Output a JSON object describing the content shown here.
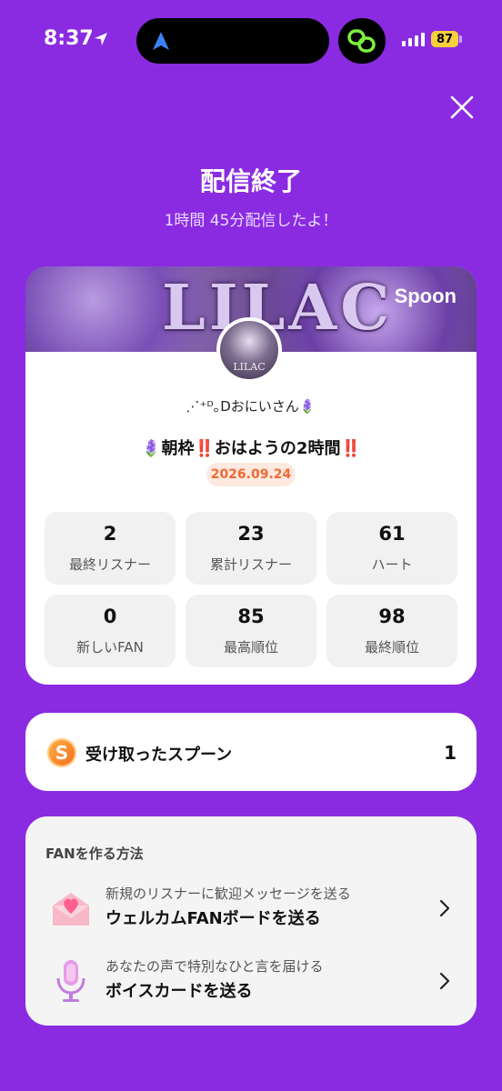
{
  "status_bar": {
    "time": "8:37",
    "battery": "87"
  },
  "header": {
    "title": "配信終了",
    "subtitle": "1時間 45分配信したよ！"
  },
  "card": {
    "banner_text": "LILAC",
    "brand": "Spoon",
    "avatar_label": "LILAC",
    "username": "⋰⁺ᴰ｡Dおにいさん🪻",
    "show_title": "🪻朝枠‼️おはようの2時間‼️",
    "date": "2026.09.24",
    "stats": [
      {
        "value": "2",
        "label": "最終リスナー"
      },
      {
        "value": "23",
        "label": "累計リスナー"
      },
      {
        "value": "61",
        "label": "ハート"
      },
      {
        "value": "0",
        "label": "新しいFAN"
      },
      {
        "value": "85",
        "label": "最高順位"
      },
      {
        "value": "98",
        "label": "最終順位"
      }
    ]
  },
  "spoons": {
    "coin": "S",
    "label": "受け取ったスプーン",
    "count": "1"
  },
  "fan": {
    "heading": "FANを作る方法",
    "items": [
      {
        "sub": "新規のリスナーに歓迎メッセージを送る",
        "main": "ウェルカムFANボードを送る",
        "icon": "envelope-heart-icon"
      },
      {
        "sub": "あなたの声で特別なひと言を届ける",
        "main": "ボイスカードを送る",
        "icon": "microphone-icon"
      }
    ]
  },
  "colors": {
    "background": "#8a2be2",
    "date_badge": "#f06a33",
    "coin": "#f26b1d"
  }
}
